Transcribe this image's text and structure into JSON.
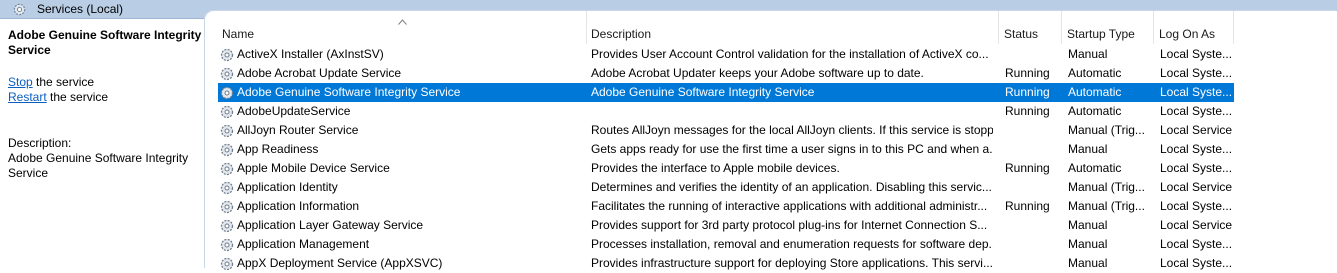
{
  "window": {
    "title": "Services (Local)"
  },
  "left_pane": {
    "service_name": "Adobe Genuine Software Integrity Service",
    "stop_link": "Stop",
    "stop_suffix": " the service",
    "restart_link": "Restart",
    "restart_suffix": " the service",
    "description_label": "Description:",
    "description": "Adobe Genuine Software Integrity Service"
  },
  "columns": {
    "name": "Name",
    "description": "Description",
    "status": "Status",
    "startup": "Startup Type",
    "logon": "Log On As"
  },
  "colors": {
    "selection": "#0078d7",
    "titlebar": "#b9cde4",
    "link": "#0b5fc1"
  },
  "rows": [
    {
      "name": "ActiveX Installer (AxInstSV)",
      "description": "Provides User Account Control validation for the installation of ActiveX co...",
      "status": "",
      "startup": "Manual",
      "logon": "Local Syste..."
    },
    {
      "name": "Adobe Acrobat Update Service",
      "description": "Adobe Acrobat Updater keeps your Adobe software up to date.",
      "status": "Running",
      "startup": "Automatic",
      "logon": "Local Syste..."
    },
    {
      "name": "Adobe Genuine Software Integrity Service",
      "description": "Adobe Genuine Software Integrity Service",
      "status": "Running",
      "startup": "Automatic",
      "logon": "Local Syste...",
      "selected": true
    },
    {
      "name": "AdobeUpdateService",
      "description": "",
      "status": "Running",
      "startup": "Automatic",
      "logon": "Local Syste..."
    },
    {
      "name": "AllJoyn Router Service",
      "description": "Routes AllJoyn messages for the local AllJoyn clients. If this service is stopp...",
      "status": "",
      "startup": "Manual (Trig...",
      "logon": "Local Service"
    },
    {
      "name": "App Readiness",
      "description": "Gets apps ready for use the first time a user signs in to this PC and when a...",
      "status": "",
      "startup": "Manual",
      "logon": "Local Syste..."
    },
    {
      "name": "Apple Mobile Device Service",
      "description": "Provides the interface to Apple mobile devices.",
      "status": "Running",
      "startup": "Automatic",
      "logon": "Local Syste..."
    },
    {
      "name": "Application Identity",
      "description": "Determines and verifies the identity of an application. Disabling this servic...",
      "status": "",
      "startup": "Manual (Trig...",
      "logon": "Local Service"
    },
    {
      "name": "Application Information",
      "description": "Facilitates the running of interactive applications with additional administr...",
      "status": "Running",
      "startup": "Manual (Trig...",
      "logon": "Local Syste..."
    },
    {
      "name": "Application Layer Gateway Service",
      "description": "Provides support for 3rd party protocol plug-ins for Internet Connection S...",
      "status": "",
      "startup": "Manual",
      "logon": "Local Service"
    },
    {
      "name": "Application Management",
      "description": "Processes installation, removal and enumeration requests for software dep...",
      "status": "",
      "startup": "Manual",
      "logon": "Local Syste..."
    },
    {
      "name": "AppX Deployment Service (AppXSVC)",
      "description": "Provides infrastructure support for deploying Store applications. This servi...",
      "status": "",
      "startup": "Manual",
      "logon": "Local Syste..."
    }
  ]
}
